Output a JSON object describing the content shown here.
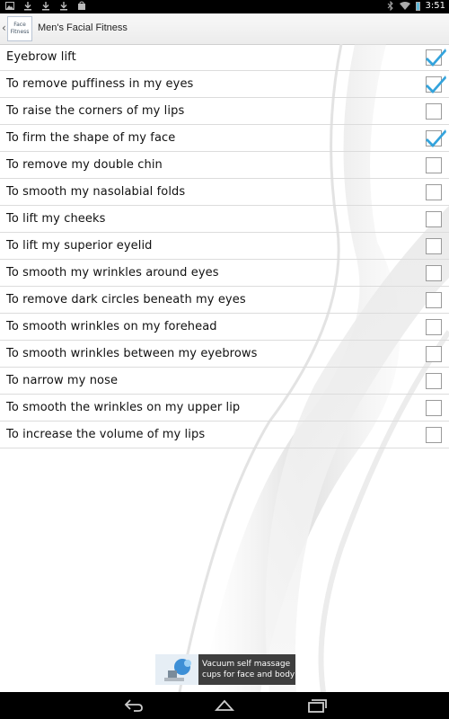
{
  "status_bar": {
    "time": "3:51",
    "left_icons": [
      "image-icon",
      "download-icon",
      "download-icon",
      "download-icon",
      "cart-icon"
    ],
    "right_icons": [
      "bluetooth-icon",
      "wifi-icon",
      "battery-icon"
    ]
  },
  "action_bar": {
    "title": "Men's Facial Fitness",
    "logo_line1": "Face",
    "logo_line2": "Fitness"
  },
  "items": [
    {
      "label": "Eyebrow lift",
      "checked": true
    },
    {
      "label": "To remove puffiness in my eyes",
      "checked": true
    },
    {
      "label": "To raise the corners of my lips",
      "checked": false
    },
    {
      "label": "To firm the shape of my face",
      "checked": true
    },
    {
      "label": "To remove my double chin",
      "checked": false
    },
    {
      "label": "To smooth my nasolabial folds",
      "checked": false
    },
    {
      "label": "To lift my cheeks",
      "checked": false
    },
    {
      "label": "To lift my superior eyelid",
      "checked": false
    },
    {
      "label": "To smooth my wrinkles around eyes",
      "checked": false
    },
    {
      "label": "To remove dark circles beneath my eyes",
      "checked": false
    },
    {
      "label": "To smooth wrinkles on my forehead",
      "checked": false
    },
    {
      "label": "To smooth wrinkles between my eyebrows",
      "checked": false
    },
    {
      "label": "To narrow my nose",
      "checked": false
    },
    {
      "label": "To smooth the wrinkles on my upper lip",
      "checked": false
    },
    {
      "label": "To increase the volume of my lips",
      "checked": false
    }
  ],
  "ad": {
    "line1": "Vacuum self  massage",
    "line2": "cups for face and body"
  },
  "nav_bar": {
    "buttons": [
      "back-icon",
      "home-icon",
      "recents-icon"
    ]
  },
  "colors": {
    "check": "#33a3dc",
    "status_bar": "#000000",
    "nav_bar": "#000000"
  }
}
